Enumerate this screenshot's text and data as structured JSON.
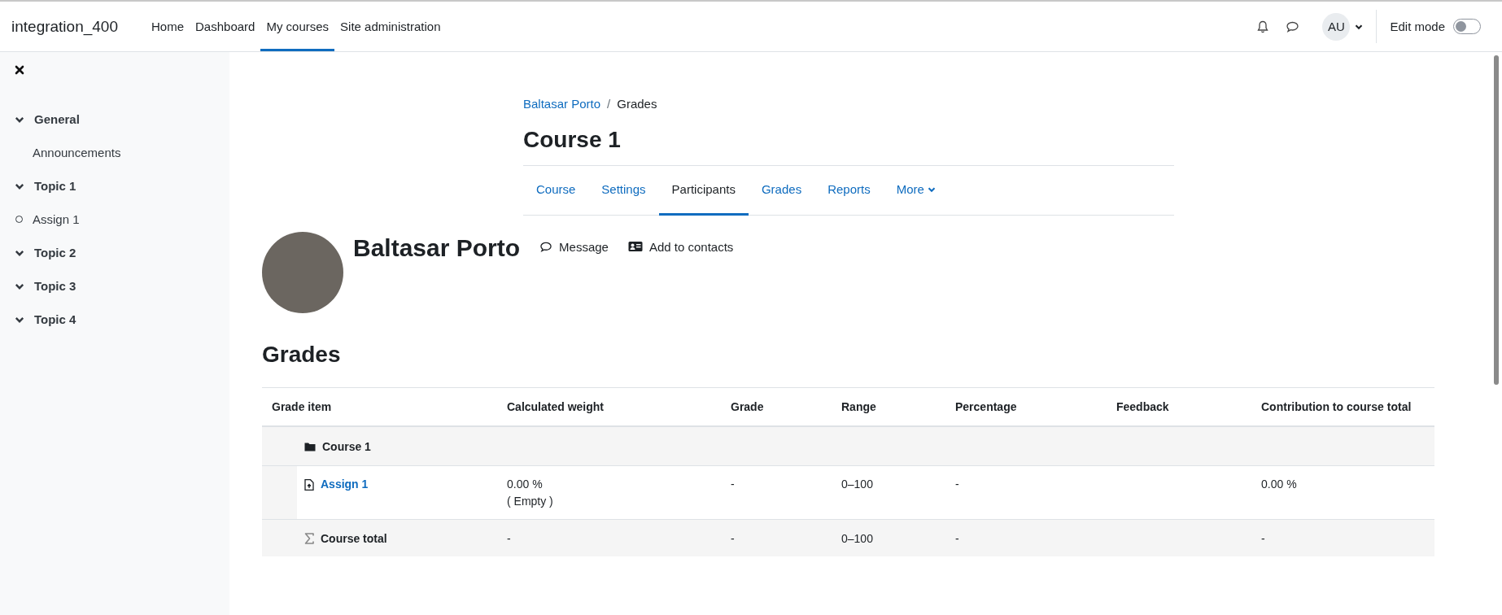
{
  "site_name": "integration_400",
  "primary_nav": [
    {
      "label": "Home",
      "selected": false
    },
    {
      "label": "Dashboard",
      "selected": false
    },
    {
      "label": "My courses",
      "selected": true
    },
    {
      "label": "Site administration",
      "selected": false
    }
  ],
  "user_menu": {
    "initials": "AU"
  },
  "edit_mode": {
    "label": "Edit mode",
    "on": false
  },
  "course_index": {
    "sections": [
      {
        "title": "General",
        "expanded": true,
        "children": [
          {
            "title": "Announcements",
            "kind": "page"
          }
        ]
      },
      {
        "title": "Topic 1",
        "expanded": true,
        "children": [
          {
            "title": "Assign 1",
            "kind": "activity",
            "completed": false
          }
        ]
      },
      {
        "title": "Topic 2",
        "expanded": true
      },
      {
        "title": "Topic 3",
        "expanded": true
      },
      {
        "title": "Topic 4",
        "expanded": true
      }
    ]
  },
  "breadcrumb": {
    "separator": "/",
    "items": [
      {
        "label": "Baltasar Porto",
        "link": true
      },
      {
        "label": "Grades",
        "link": false
      }
    ]
  },
  "course_title": "Course 1",
  "secondary_nav": [
    {
      "label": "Course",
      "selected": false,
      "dropdown": false
    },
    {
      "label": "Settings",
      "selected": false,
      "dropdown": false
    },
    {
      "label": "Participants",
      "selected": true,
      "dropdown": false
    },
    {
      "label": "Grades",
      "selected": false,
      "dropdown": false
    },
    {
      "label": "Reports",
      "selected": false,
      "dropdown": false
    },
    {
      "label": "More",
      "selected": false,
      "dropdown": true
    }
  ],
  "profile": {
    "name": "Baltasar Porto",
    "actions": [
      {
        "label": "Message",
        "kind": "message"
      },
      {
        "label": "Add to contacts",
        "kind": "contact"
      }
    ]
  },
  "grades": {
    "heading": "Grades",
    "table": {
      "columns": [
        "Grade item",
        "Calculated weight",
        "Grade",
        "Range",
        "Percentage",
        "Feedback",
        "Contribution to course total"
      ],
      "rows": [
        {
          "kind": "category",
          "grade_item": "Course 1"
        },
        {
          "kind": "item",
          "grade_item": "Assign 1",
          "calculated_weight": "0.00 %",
          "weight_note": "( Empty )",
          "grade": "-",
          "range": "0–100",
          "percentage": "-",
          "contribution": "0.00 %"
        },
        {
          "kind": "total",
          "grade_item": "Course total",
          "calculated_weight": "-",
          "grade": "-",
          "range": "0–100",
          "percentage": "-",
          "contribution": "-"
        }
      ]
    }
  }
}
